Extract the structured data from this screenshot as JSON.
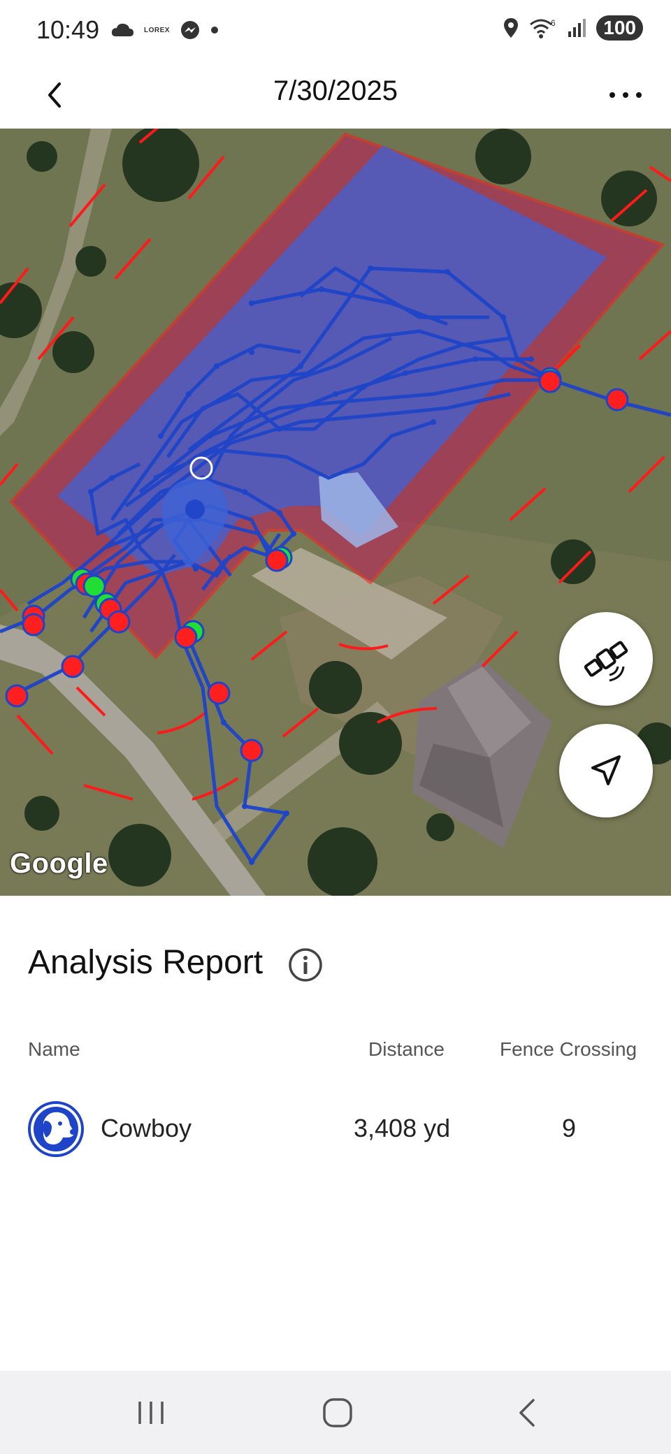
{
  "status_bar": {
    "time": "10:49",
    "icons_left": [
      "cloud-icon",
      "lorex-icon",
      "messenger-icon",
      "dot-icon"
    ],
    "lorex_text": "LOREX",
    "icons_right": [
      "location-icon",
      "wifi-6-icon",
      "signal-icon"
    ],
    "battery": "100"
  },
  "app_bar": {
    "title": "7/30/2025",
    "back_icon": "chevron-left-icon",
    "more_icon": "more-horizontal-icon"
  },
  "map": {
    "google_label": "Google",
    "buttons": [
      "satellite-icon",
      "navigate-icon"
    ],
    "colors": {
      "fence_line": "#ff1a1a",
      "fence_fill": "#c2185b",
      "area_fill": "#3f63d6",
      "track": "#1e44c8",
      "crossing_out": "#ff1f1f",
      "crossing_in": "#22dd33"
    }
  },
  "report": {
    "title": "Analysis Report",
    "info_icon": "info-icon",
    "columns": {
      "name": "Name",
      "distance": "Distance",
      "fence_crossing": "Fence Crossing"
    },
    "rows": [
      {
        "avatar_icon": "dog-icon",
        "name": "Cowboy",
        "distance": "3,408 yd",
        "fence_crossing": "9"
      }
    ]
  },
  "nav_bar": {
    "buttons": [
      "recent-apps-icon",
      "home-icon",
      "back-icon"
    ]
  }
}
